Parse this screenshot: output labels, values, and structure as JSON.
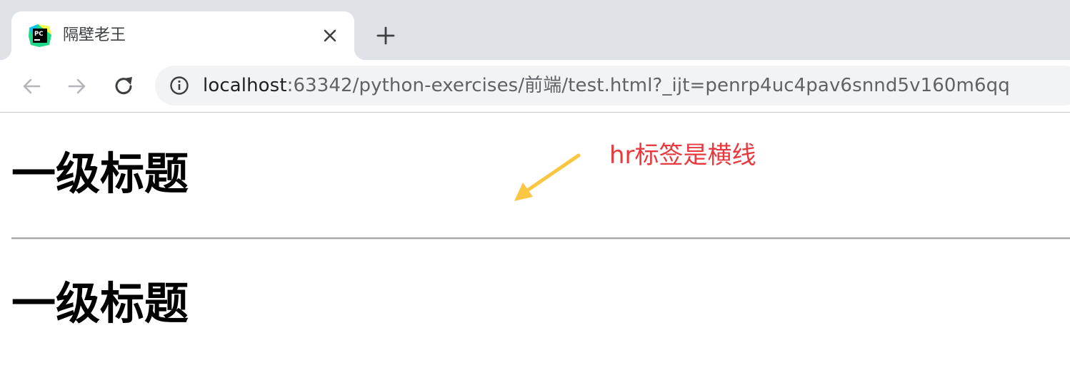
{
  "tab": {
    "title": "隔壁老王",
    "favicon_text": "PC"
  },
  "address_bar": {
    "host": "localhost",
    "rest": ":63342/python-exercises/前端/test.html?_ijt=penrp4uc4pav6snnd5v160m6qq"
  },
  "icons": {
    "tab_close": "close-icon",
    "new_tab": "plus-icon",
    "back": "arrow-left-icon",
    "forward": "arrow-right-icon",
    "reload": "reload-icon",
    "site_info": "info-icon"
  },
  "page": {
    "heading_1": "一级标题",
    "heading_2": "一级标题",
    "annotation": "hr标签是横线"
  },
  "colors": {
    "tabstrip": "#dee1e6",
    "omnibox": "#f1f3f4",
    "annotation": "#e8393f",
    "arrow": "#fbc641",
    "hr": "#a6a6a6"
  }
}
